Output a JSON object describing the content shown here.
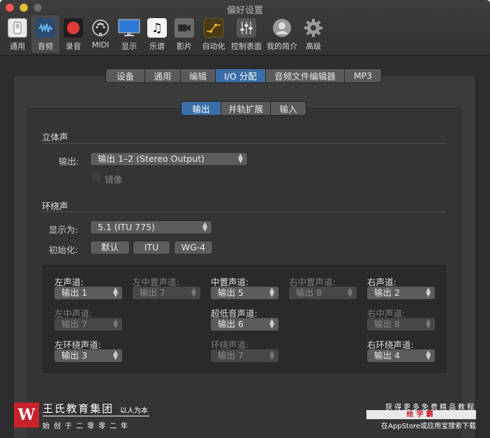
{
  "window": {
    "title": "偏好设置"
  },
  "toolbar": {
    "items": [
      {
        "label": "通用",
        "icon": "general-switch-icon"
      },
      {
        "label": "音频",
        "icon": "audio-waveform-icon"
      },
      {
        "label": "录音",
        "icon": "record-icon"
      },
      {
        "label": "MIDI",
        "icon": "midi-connector-icon"
      },
      {
        "label": "显示",
        "icon": "display-monitor-icon"
      },
      {
        "label": "乐谱",
        "icon": "score-note-icon"
      },
      {
        "label": "影片",
        "icon": "movie-camera-icon"
      },
      {
        "label": "自动化",
        "icon": "automation-curve-icon"
      },
      {
        "label": "控制表面",
        "icon": "control-surface-faders-icon"
      },
      {
        "label": "我的简介",
        "icon": "user-profile-icon"
      },
      {
        "label": "高级",
        "icon": "advanced-gear-icon"
      }
    ],
    "selected": "音频"
  },
  "tabs": {
    "items": [
      "设备",
      "通用",
      "编辑",
      "I/O 分配",
      "音频文件编辑器",
      "MP3"
    ],
    "active": "I/O 分配"
  },
  "subtabs": {
    "items": [
      "输出",
      "并轨扩展",
      "输入"
    ],
    "active": "输出"
  },
  "stereo": {
    "title": "立体声",
    "output_label": "输出:",
    "output_value": "输出 1–2 (Stereo Output)",
    "mirror_label": "镜像"
  },
  "surround": {
    "title": "环绕声",
    "display_label": "显示为:",
    "display_value": "5.1 (ITU 775)",
    "init_label": "初始化:",
    "init_buttons": [
      "默认",
      "ITU",
      "WG-4"
    ]
  },
  "channels": {
    "left": {
      "label": "左声道:",
      "value": "输出 1"
    },
    "left_center": {
      "label": "左中置声道:",
      "value": "输出 7"
    },
    "center": {
      "label": "中置声道:",
      "value": "输出 5"
    },
    "right_center": {
      "label": "右中置声道:",
      "value": "输出 8"
    },
    "right": {
      "label": "右声道:",
      "value": "输出 2"
    },
    "left_mid": {
      "label": "左中声道:",
      "value": "输出 7"
    },
    "lfe": {
      "label": "超低音声道:",
      "value": "输出 6"
    },
    "right_mid": {
      "label": "右中声道:",
      "value": "输出 8"
    },
    "left_surround": {
      "label": "左环绕声道:",
      "value": "输出 3"
    },
    "surround": {
      "label": "环绕声道:",
      "value": "输出 7"
    },
    "right_surround": {
      "label": "右环绕声道:",
      "value": "输出 4"
    }
  },
  "watermark": {
    "logo_text": "W",
    "name": "王氏教育集团",
    "slogan": "以人为本",
    "founded": "始创于二零零二年",
    "right_line1": "获得更多免费精品教程",
    "right_line2": "绘学霸",
    "right_line3": "在AppStore或应用宝搜索下载"
  },
  "colors": {
    "accent": "#3a6ea8",
    "window_bg": "#2d2d2d",
    "close": "#fc5b57",
    "minimize": "#e5bf3c",
    "watermark_red": "#c8232b"
  }
}
